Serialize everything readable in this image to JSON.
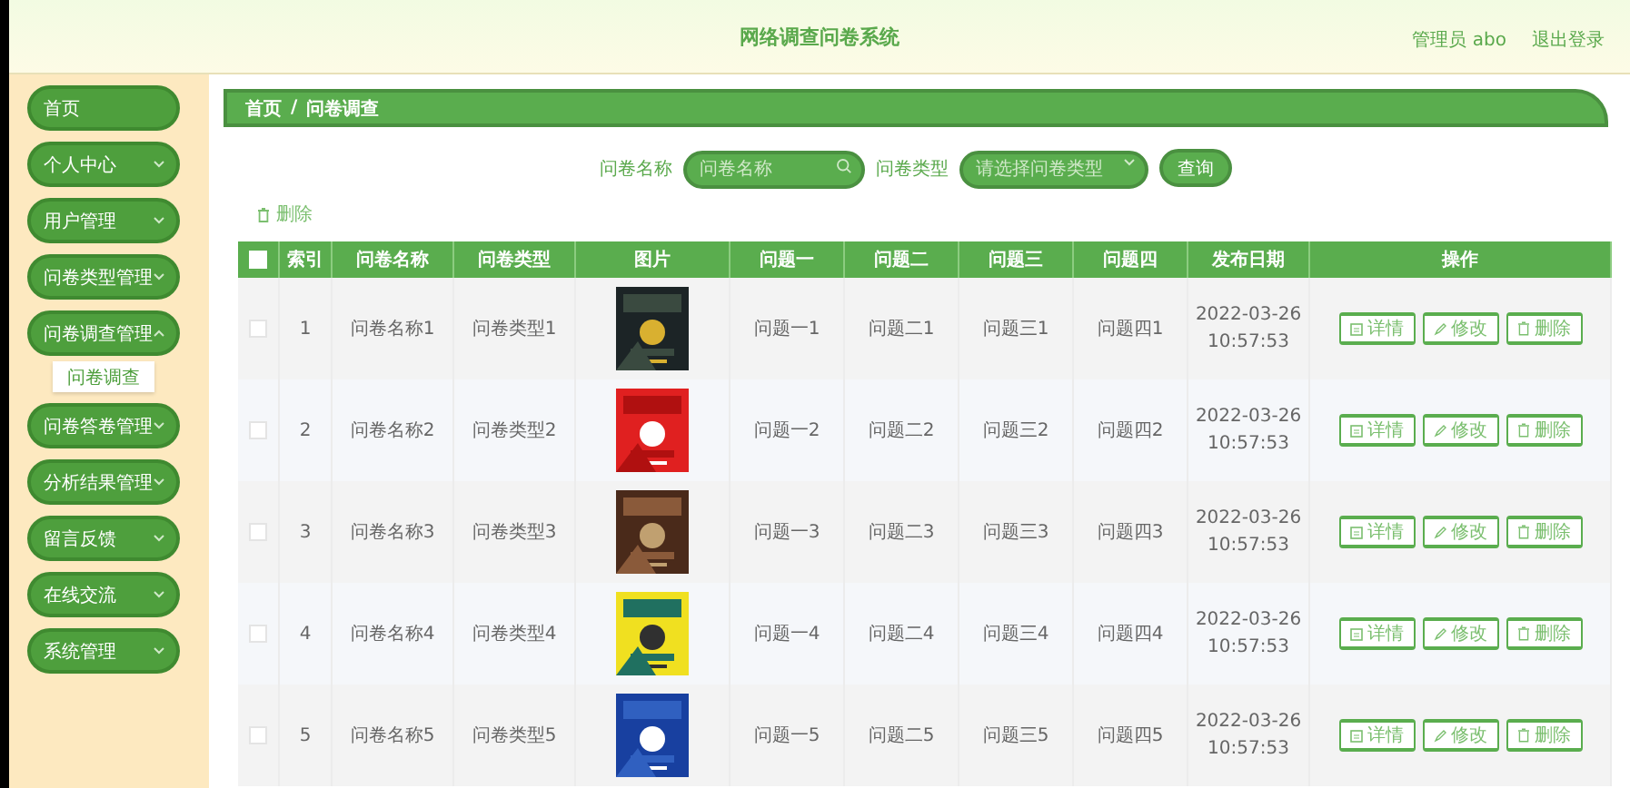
{
  "header": {
    "title": "网络调查问卷系统",
    "user": "管理员 abo",
    "logout": "退出登录"
  },
  "sidebar": {
    "items": [
      {
        "label": "首页",
        "has_arrow": false
      },
      {
        "label": "个人中心",
        "expanded": false,
        "has_arrow": true
      },
      {
        "label": "用户管理",
        "expanded": false,
        "has_arrow": true
      },
      {
        "label": "问卷类型管理",
        "expanded": false,
        "has_arrow": true
      },
      {
        "label": "问卷调查管理",
        "expanded": true,
        "has_arrow": true,
        "children": [
          {
            "label": "问卷调查",
            "selected": true
          }
        ]
      },
      {
        "label": "问卷答卷管理",
        "expanded": false,
        "has_arrow": true
      },
      {
        "label": "分析结果管理",
        "expanded": false,
        "has_arrow": true
      },
      {
        "label": "留言反馈",
        "expanded": false,
        "has_arrow": true
      },
      {
        "label": "在线交流",
        "expanded": false,
        "has_arrow": true
      },
      {
        "label": "系统管理",
        "expanded": false,
        "has_arrow": true
      }
    ]
  },
  "breadcrumb": [
    "首页",
    "/",
    "问卷调查"
  ],
  "search": {
    "name_label": "问卷名称",
    "name_placeholder": "问卷名称",
    "type_label": "问卷类型",
    "type_placeholder": "请选择问卷类型",
    "button": "查询"
  },
  "delete_button": "删除",
  "table": {
    "header_checked": false,
    "columns": [
      "索引",
      "问卷名称",
      "问卷类型",
      "图片",
      "问题一",
      "问题二",
      "问题三",
      "问题四",
      "发布日期",
      "操作"
    ],
    "rows": [
      {
        "checked": false,
        "cells": [
          "1",
          "问卷名称1",
          "问卷类型1",
          {
            "kind": "picture"
          },
          "问题一1",
          "问题二1",
          "问题三1",
          "问题四1",
          "2022-03-26 10:57:53"
        ],
        "actions": [
          "详情",
          "修改",
          "删除"
        ]
      },
      {
        "checked": false,
        "cells": [
          "2",
          "问卷名称2",
          "问卷类型2",
          {
            "kind": "picture"
          },
          "问题一2",
          "问题二2",
          "问题三2",
          "问题四2",
          "2022-03-26 10:57:53"
        ],
        "actions": [
          "详情",
          "修改",
          "删除"
        ]
      },
      {
        "checked": false,
        "cells": [
          "3",
          "问卷名称3",
          "问卷类型3",
          {
            "kind": "picture"
          },
          "问题一3",
          "问题二3",
          "问题三3",
          "问题四3",
          "2022-03-26 10:57:53"
        ],
        "actions": [
          "详情",
          "修改",
          "删除"
        ]
      },
      {
        "checked": false,
        "cells": [
          "4",
          "问卷名称4",
          "问卷类型4",
          {
            "kind": "picture"
          },
          "问题一4",
          "问题二4",
          "问题三4",
          "问题四4",
          "2022-03-26 10:57:53"
        ],
        "actions": [
          "详情",
          "修改",
          "删除"
        ]
      },
      {
        "checked": false,
        "cells": [
          "5",
          "问卷名称5",
          "问卷类型5",
          {
            "kind": "picture"
          },
          "问题一5",
          "问题二5",
          "问题三5",
          "问题四5",
          "2022-03-26 10:57:53"
        ],
        "actions": [
          "详情",
          "修改",
          "删除"
        ]
      }
    ]
  }
}
